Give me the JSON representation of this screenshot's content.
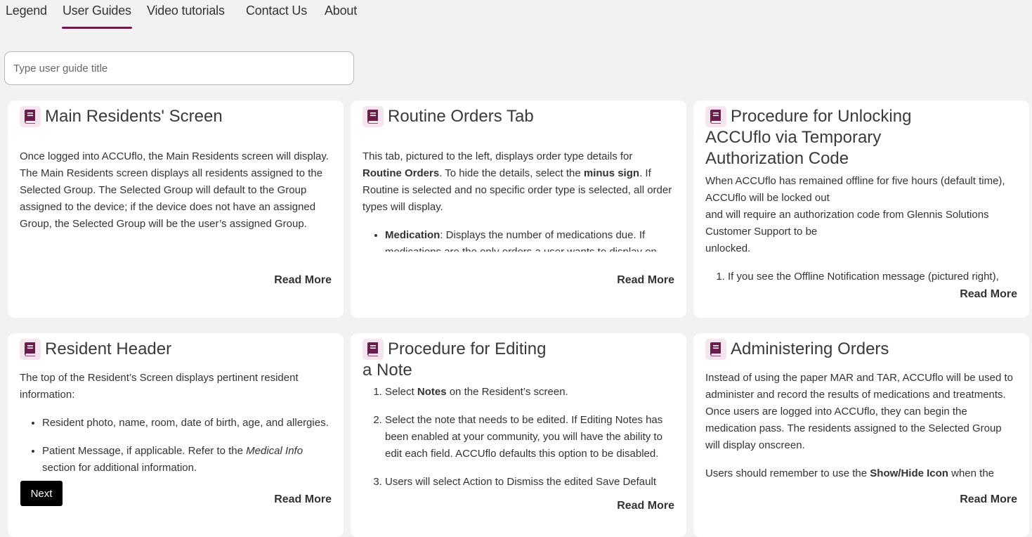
{
  "nav": {
    "tabs": [
      {
        "label": "Legend"
      },
      {
        "label": "User Guides",
        "active": true
      },
      {
        "label": "Video tutorials"
      },
      {
        "label": "Contact Us"
      },
      {
        "label": "About"
      }
    ]
  },
  "search": {
    "placeholder": "Type user guide title",
    "value": ""
  },
  "colors": {
    "accent": "#6b1c4b",
    "icon_bg": "#f6e4ee",
    "page_bg": "#f2f2f2"
  },
  "cards": [
    {
      "icon": "book-icon",
      "title": "Main Residents' Screen",
      "body": "Once logged into ACCUflo, the Main Residents screen will display. The Main Residents screen displays all residents assigned to the Selected Group.  The Selected Group will default to the Group assigned to the device; if the device does not have an assigned Group, the Selected Group will be the user’s assigned Group.",
      "read_more": "Read More"
    },
    {
      "icon": "book-icon",
      "title": "Routine Orders Tab",
      "body_parts": [
        "This tab, pictured to the left, displays order type details for ",
        "Routine Orders",
        ".  To hide the details, select the ",
        "minus sign",
        ".  If Routine is selected and no specific order type is selected, all order types will display."
      ],
      "bullet_bold": "Medication",
      "bullet_text": ": Displays the number of medications due.  If medications are the only orders a user wants to display on",
      "read_more": "Read More"
    },
    {
      "icon": "book-icon",
      "title": "Procedure for Unlocking ACCUflo via Temporary Authorization Code",
      "body_lines": [
        "When ACCUflo has remained offline for five hours (default time), ACCUflo will be locked out",
        "and will require an authorization code from Glennis Solutions Customer Support to be",
        "unlocked."
      ],
      "list_item": "If you see the Offline Notification message (pictured right),",
      "read_more": "Read More"
    },
    {
      "icon": "book-icon",
      "title": "Resident Header",
      "body": "The top of the Resident’s Screen displays pertinent resident information:",
      "bullet_1": "Resident photo, name, room, date of birth, age, and allergies.",
      "bullet_2_parts": [
        "Patient Message, if applicable.  Refer to the ",
        "Medical Info",
        " section for additional information."
      ],
      "read_more": "Read More"
    },
    {
      "icon": "book-icon",
      "title": "Procedure for Editing a Note",
      "step_1_parts": [
        "Select ",
        "Notes",
        " on the Resident’s screen."
      ],
      "step_2": "Select the note that needs to be edited. If Editing Notes has been enabled at your community, you will have the ability to edit each field. ACCUflo defaults this option to be disabled.",
      "step_3": "Users will select Action to Dismiss the edited Save Default",
      "read_more": "Read More"
    },
    {
      "icon": "book-icon",
      "title": "Administering Orders",
      "body": "Instead of using the paper MAR and TAR, ACCUflo will be used to administer and record the results of medications and treatments.  Once users are logged into ACCUflo, they can begin the medication pass.  The residents assigned to the Selected Group will display onscreen.",
      "body2_parts": [
        "Users should remember to use the ",
        "Show/Hide Icon",
        " when the"
      ],
      "read_more": "Read More"
    }
  ],
  "next_button": "Next"
}
